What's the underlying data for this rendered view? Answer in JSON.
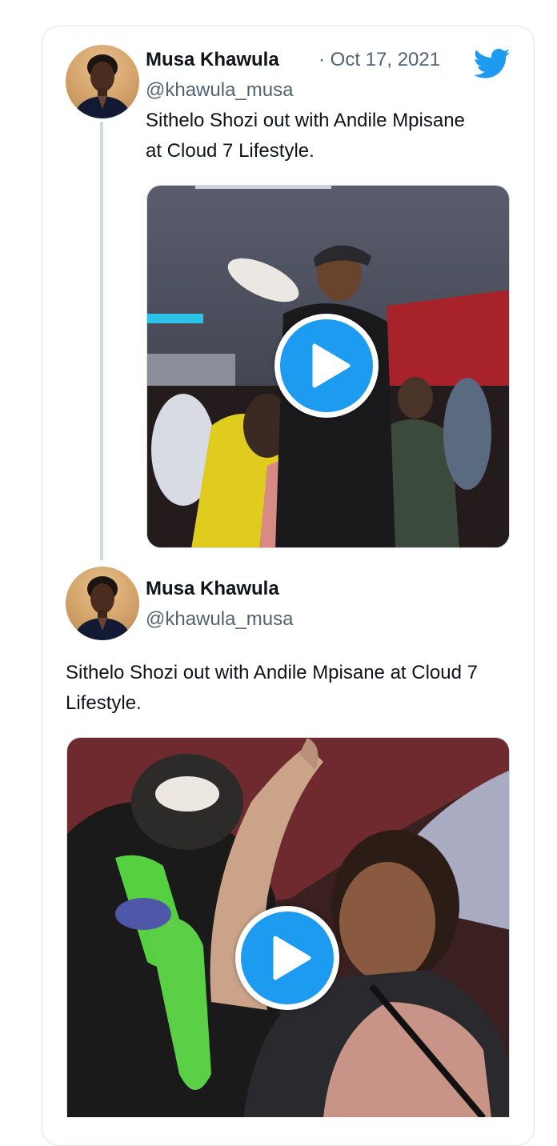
{
  "tweet1": {
    "author_name": "Musa Khawula",
    "handle": "@khawula_musa",
    "date": "· Oct 17, 2021",
    "text": "Sithelo Shozi out with Andile Mpisane at Cloud 7 Lifestyle."
  },
  "tweet2": {
    "author_name": "Musa Khawula",
    "handle": "@khawula_musa",
    "text": "Sithelo Shozi out with Andile Mpisane at Cloud 7 Lifestyle."
  },
  "icons": {
    "brand": "twitter-bird-icon",
    "play": "play-icon"
  },
  "colors": {
    "twitter_blue": "#1d9bf0",
    "secondary_text": "#536471",
    "thread_line": "#cfd9de"
  }
}
